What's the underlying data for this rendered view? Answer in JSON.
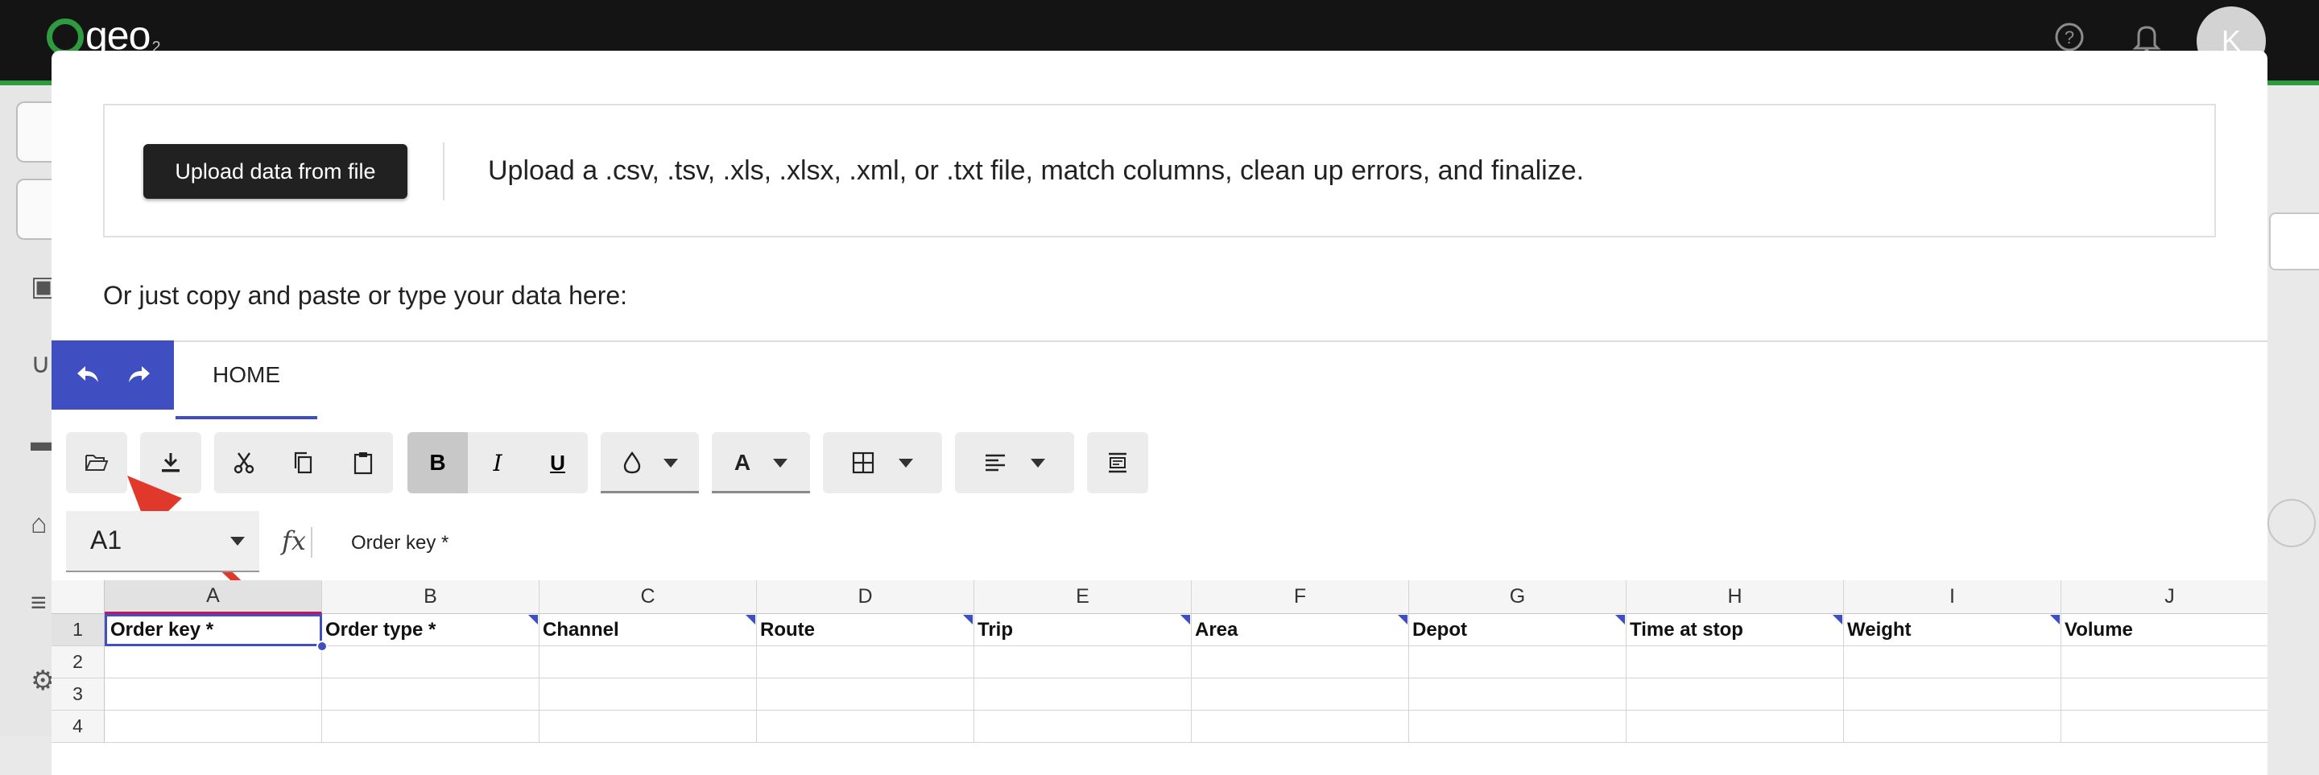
{
  "app": {
    "logo_text": "geo",
    "logo_sub": "2",
    "help_icon": "help-circle-icon",
    "bell_icon": "bell-icon",
    "avatar_initial": "K"
  },
  "modal": {
    "upload_button": "Upload data from file",
    "upload_description": "Upload a .csv, .tsv, .xls, .xlsx, .xml, or .txt file, match columns, clean up errors, and finalize.",
    "paste_instruction": "Or just copy and paste or type your data here:"
  },
  "ribbon": {
    "home_tab": "HOME",
    "bold": "B",
    "italic": "I",
    "underline": "U",
    "font_color": "A"
  },
  "formula_bar": {
    "name_box": "A1",
    "fx_label": "fx",
    "value": "Order key *"
  },
  "sheet": {
    "columns": [
      "A",
      "B",
      "C",
      "D",
      "E",
      "F",
      "G",
      "H",
      "I",
      "J"
    ],
    "rows": [
      "1",
      "2",
      "3",
      "4"
    ],
    "header_cells": [
      "Order key *",
      "Order type *",
      "Channel",
      "Route",
      "Trip",
      "Area",
      "Depot",
      "Time at stop",
      "Weight",
      "Volume"
    ],
    "selected_cell": "A1"
  },
  "colors": {
    "accent": "#3f4fc1",
    "brand_green": "#2e9b3e",
    "annotation_arrow": "#e0392b",
    "selected_column_marker": "#c2185b"
  }
}
